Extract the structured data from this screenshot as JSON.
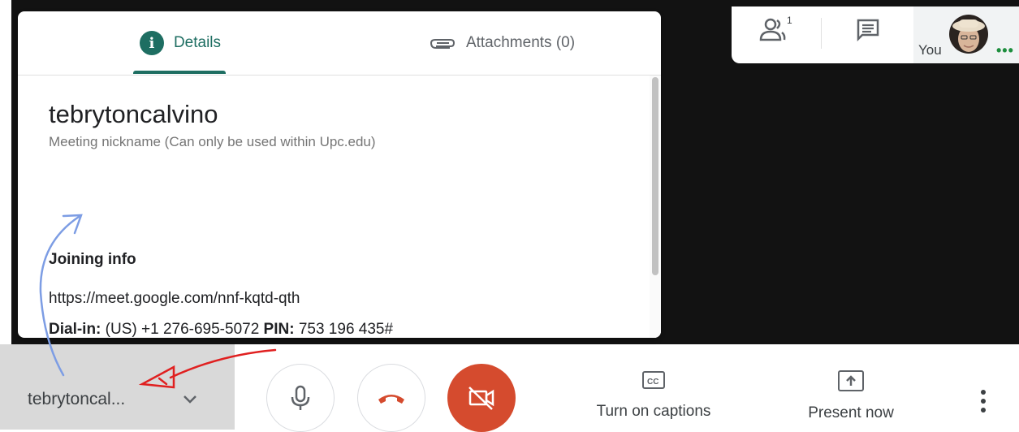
{
  "panel": {
    "tabs": [
      {
        "label": "Details"
      },
      {
        "label": "Attachments (0)"
      }
    ],
    "meeting_name": "tebrytoncalvino",
    "nickname_desc": "Meeting nickname (Can only be used within Upc.edu)",
    "joining_title": "Joining info",
    "meet_link": "https://meet.google.com/nnf-kqtd-qth",
    "dialin": {
      "label": "Dial-in:",
      "value": "(US) +1 276-695-5072",
      "pin_label": "PIN:",
      "pin_value": "753 196 435#"
    }
  },
  "top_right": {
    "people_count": "1",
    "you_label": "You",
    "more": "•••"
  },
  "bottom_bar": {
    "meeting_chip_label": "tebrytoncal...",
    "captions_label": "Turn on captions",
    "present_label": "Present now"
  },
  "colors": {
    "accent": "#1e6e62",
    "hangup": "#d54b2e",
    "annotation_red": "#e02020",
    "annotation_blue": "#7d9de4"
  }
}
